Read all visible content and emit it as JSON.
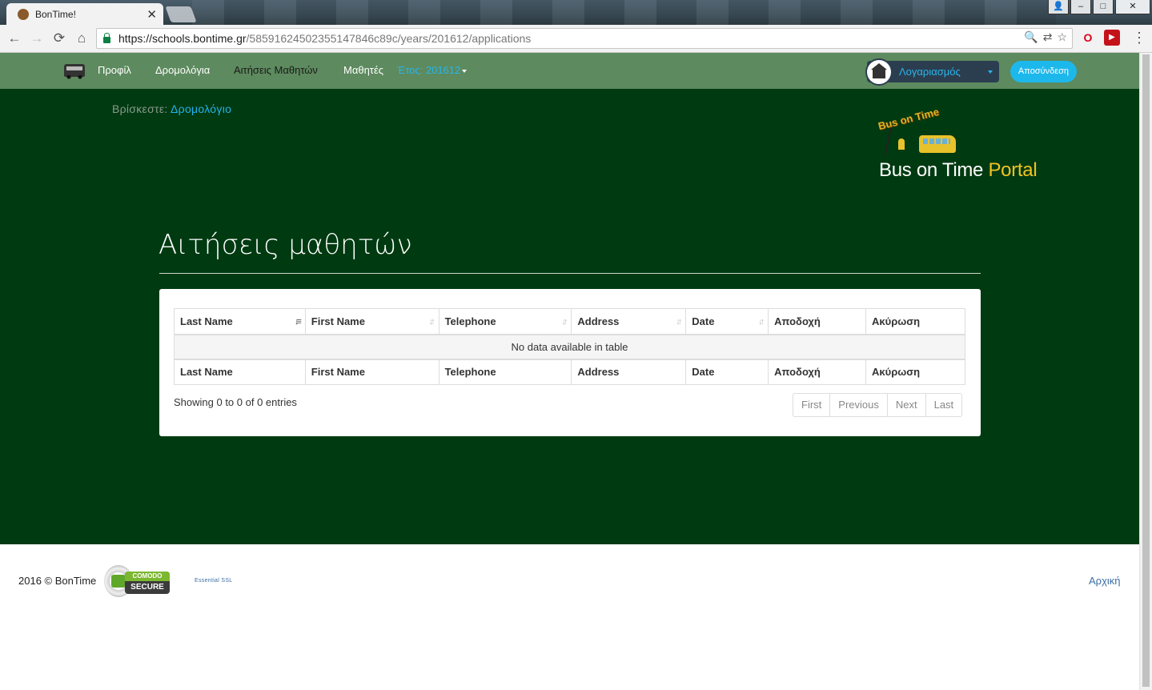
{
  "browser": {
    "tab_title": "BonTime!",
    "tab_close": "✕",
    "url_host": "https://schools.bontime.gr",
    "url_path": "/58591624502355147846c89c/years/201612/applications",
    "nav": {
      "back": "←",
      "forward": "→",
      "reload": "⟳",
      "home": "⌂"
    },
    "window_buttons": {
      "user": "👤",
      "minimize": "–",
      "maximize": "□",
      "close": "✕"
    },
    "omnibox_icons": {
      "zoom": "🔍",
      "translate": "⇄",
      "star": "☆"
    },
    "extensions": {
      "opera": "O",
      "red": "▶",
      "menu": "⋮"
    }
  },
  "topnav": {
    "items": [
      "Προφίλ",
      "Δρομολόγια",
      "Αιτήσεις Μαθητών",
      "Μαθητές"
    ],
    "year_label": "Έτος: 201612",
    "account_label": "Λογαριασμός",
    "logout_label": "Αποσύνδεση"
  },
  "breadcrumb": {
    "prefix": "Βρίσκεστε:",
    "current": "Δρομολόγιο"
  },
  "logo": {
    "arc_text": "Bus on Time",
    "name_main": "Bus on Time ",
    "name_accent": "Portal"
  },
  "page": {
    "title": "Αιτήσεις μαθητών"
  },
  "table": {
    "columns": [
      "Last Name",
      "First Name",
      "Telephone",
      "Address",
      "Date",
      "Αποδοχή",
      "Ακύρωση"
    ],
    "sort_icons": [
      "↓≡",
      "↓↑",
      "↓↑",
      "↓↑",
      "↓↑"
    ],
    "empty_message": "No data available in table",
    "info": "Showing 0 to 0 of 0 entries",
    "pagination": [
      "First",
      "Previous",
      "Next",
      "Last"
    ]
  },
  "footer": {
    "copyright": "2016 © BonTime",
    "seal_top": "COMODO",
    "seal_bottom": "SECURE",
    "ssl_text": "Essential SSL",
    "home_link": "Αρχική"
  },
  "colors": {
    "nav_bg": "#5d8a5e",
    "hero_bg": "#003a11",
    "accent": "#1cb8ec",
    "portal_yellow": "#f2c320"
  }
}
